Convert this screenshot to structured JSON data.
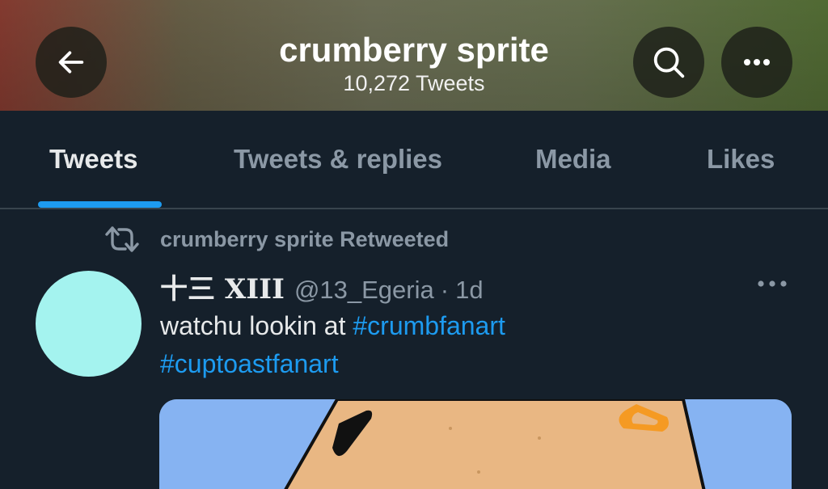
{
  "header": {
    "title": "crumberry sprite",
    "tweet_count": "10,272 Tweets",
    "back_icon": "arrow-left-icon",
    "search_icon": "search-icon",
    "more_icon": "ellipsis-horizontal-icon"
  },
  "tabs": [
    {
      "label": "Tweets",
      "active": true
    },
    {
      "label": "Tweets & replies",
      "active": false
    },
    {
      "label": "Media",
      "active": false
    },
    {
      "label": "Likes",
      "active": false
    }
  ],
  "tweet": {
    "retweet_label": "crumberry sprite Retweeted",
    "retweet_icon": "retweet-icon",
    "author_name": "十三 XIII",
    "handle": "@13_Egeria",
    "separator": "·",
    "time": "1d",
    "text": "watchu lookin at",
    "hashtags": [
      "#crumbfanart",
      "#cuptoastfanart"
    ],
    "more_icon": "ellipsis-horizontal-icon",
    "avatar_color": "#a4f3ef"
  },
  "colors": {
    "background": "#15202b",
    "accent": "#1d9bf0",
    "muted_text": "#8b98a5",
    "divider": "#38444d"
  }
}
